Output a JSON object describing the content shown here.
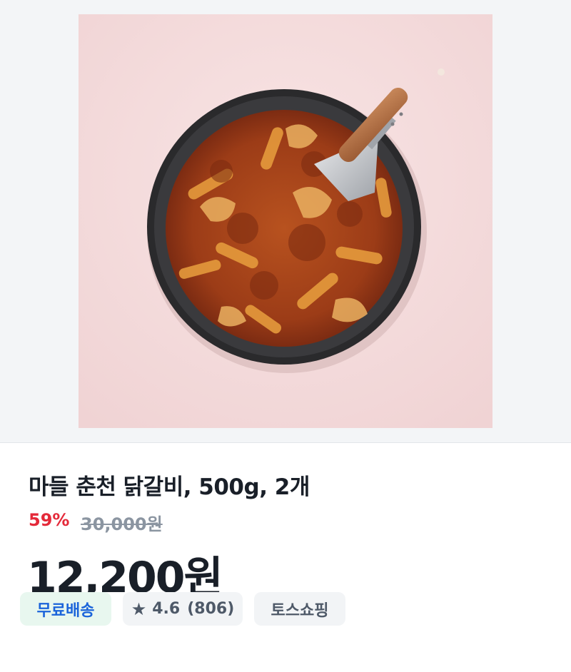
{
  "product": {
    "title": "마들 춘천 닭갈비, 500g, 2개",
    "discount": "59%",
    "original_price": "30,000원",
    "price": "12,200원"
  },
  "badges": {
    "shipping": "무료배송",
    "rating_icon": "star-icon",
    "rating": "4.6",
    "review_count": "(806)",
    "seller": "토스쇼핑"
  },
  "colors": {
    "discount": "#e42939",
    "shipping_text": "#1b64da",
    "shipping_bg": "#e8f7ef"
  }
}
